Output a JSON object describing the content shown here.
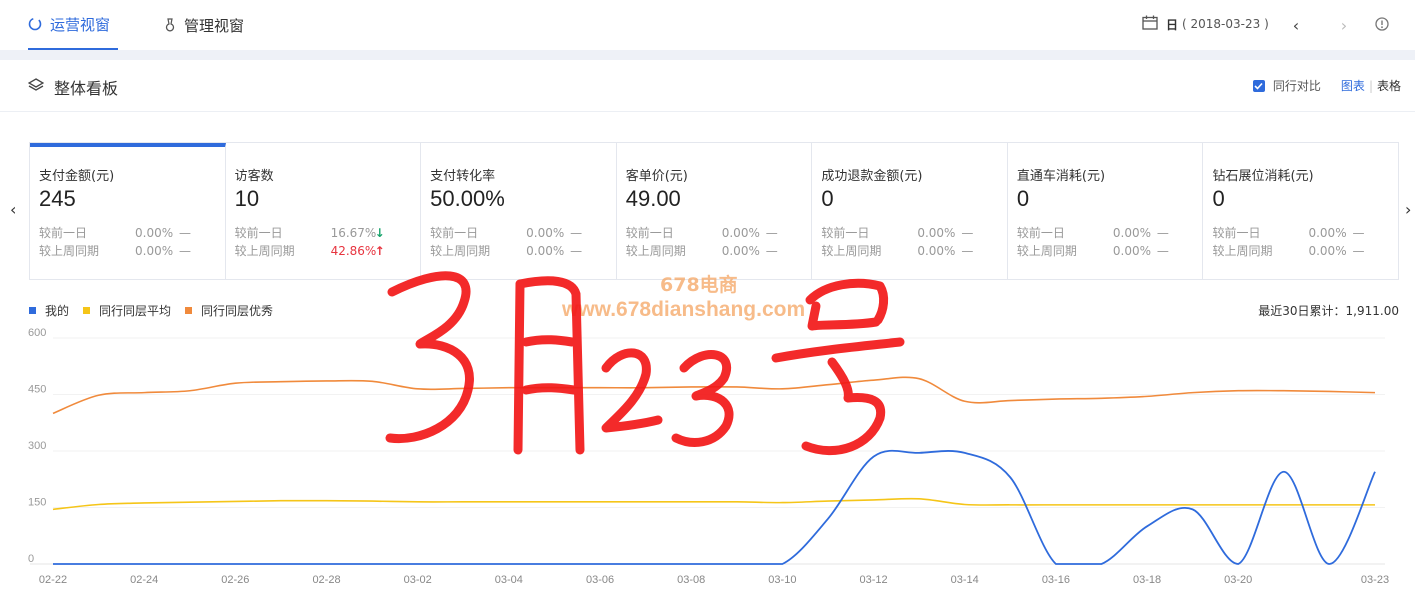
{
  "tabs": [
    {
      "label": "运营视窗",
      "active": true
    },
    {
      "label": "管理视窗",
      "active": false
    }
  ],
  "date": {
    "unit": "日",
    "value": "( 2018-03-23 )"
  },
  "section": {
    "title": "整体看板",
    "compare_label": "同行对比",
    "view_chart": "图表",
    "view_table": "表格",
    "separator": "|"
  },
  "metrics": [
    {
      "name": "支付金额(元)",
      "value": "245",
      "rows": [
        {
          "label": "较前一日",
          "pct": "0.00%",
          "trend": "—"
        },
        {
          "label": "较上周同期",
          "pct": "0.00%",
          "trend": "—"
        }
      ]
    },
    {
      "name": "访客数",
      "value": "10",
      "rows": [
        {
          "label": "较前一日",
          "pct": "16.67%",
          "trend": "↓"
        },
        {
          "label": "较上周同期",
          "pct": "42.86%",
          "trend": "↑"
        }
      ]
    },
    {
      "name": "支付转化率",
      "value": "50.00%",
      "rows": [
        {
          "label": "较前一日",
          "pct": "0.00%",
          "trend": "—"
        },
        {
          "label": "较上周同期",
          "pct": "0.00%",
          "trend": "—"
        }
      ]
    },
    {
      "name": "客单价(元)",
      "value": "49.00",
      "rows": [
        {
          "label": "较前一日",
          "pct": "0.00%",
          "trend": "—"
        },
        {
          "label": "较上周同期",
          "pct": "0.00%",
          "trend": "—"
        }
      ]
    },
    {
      "name": "成功退款金额(元)",
      "value": "0",
      "rows": [
        {
          "label": "较前一日",
          "pct": "0.00%",
          "trend": "—"
        },
        {
          "label": "较上周同期",
          "pct": "0.00%",
          "trend": "—"
        }
      ]
    },
    {
      "name": "直通车消耗(元)",
      "value": "0",
      "rows": [
        {
          "label": "较前一日",
          "pct": "0.00%",
          "trend": "—"
        },
        {
          "label": "较上周同期",
          "pct": "0.00%",
          "trend": "—"
        }
      ]
    },
    {
      "name": "钻石展位消耗(元)",
      "value": "0",
      "rows": [
        {
          "label": "较前一日",
          "pct": "0.00%",
          "trend": "—"
        },
        {
          "label": "较上周同期",
          "pct": "0.00%",
          "trend": "—"
        }
      ]
    }
  ],
  "legend_total": "最近30日累计：1,911.00",
  "watermark": {
    "line1": "678电商",
    "line2": "www.678dianshang.com"
  },
  "handwriting": "3月23号",
  "colors": {
    "accent": "#2f6bdc",
    "mine": "#2f6bdc",
    "avg": "#f5c518",
    "excellent": "#f08a3c",
    "up": "#e7343f",
    "down": "#17a36b"
  },
  "chart_data": {
    "type": "line",
    "x": [
      "02-22",
      "02-23",
      "02-24",
      "02-25",
      "02-26",
      "02-27",
      "02-28",
      "03-01",
      "03-02",
      "03-03",
      "03-04",
      "03-05",
      "03-06",
      "03-07",
      "03-08",
      "03-09",
      "03-10",
      "03-11",
      "03-12",
      "03-13",
      "03-14",
      "03-15",
      "03-16",
      "03-17",
      "03-18",
      "03-19",
      "03-20",
      "03-21",
      "03-22",
      "03-23"
    ],
    "x_ticks": [
      "02-22",
      "02-24",
      "02-26",
      "02-28",
      "03-02",
      "03-04",
      "03-06",
      "03-08",
      "03-10",
      "03-12",
      "03-14",
      "03-16",
      "03-18",
      "03-20",
      "03-23"
    ],
    "y_ticks": [
      0,
      150,
      300,
      450,
      600
    ],
    "ylim": [
      0,
      600
    ],
    "legend_position": "top-left",
    "series": [
      {
        "name": "我的",
        "color": "#2f6bdc",
        "values": [
          0,
          0,
          0,
          0,
          0,
          0,
          0,
          0,
          0,
          0,
          0,
          0,
          0,
          0,
          0,
          0,
          0,
          120,
          285,
          295,
          295,
          230,
          0,
          0,
          100,
          145,
          0,
          245,
          0,
          245
        ]
      },
      {
        "name": "同行同层平均",
        "color": "#f5c518",
        "values": [
          145,
          158,
          162,
          164,
          166,
          168,
          168,
          167,
          165,
          165,
          165,
          165,
          165,
          165,
          165,
          165,
          163,
          167,
          170,
          173,
          158,
          157,
          157,
          157,
          157,
          157,
          157,
          157,
          157,
          157
        ]
      },
      {
        "name": "同行同层优秀",
        "color": "#f08a3c",
        "values": [
          400,
          448,
          455,
          460,
          480,
          484,
          486,
          485,
          465,
          466,
          468,
          468,
          468,
          468,
          470,
          470,
          465,
          476,
          488,
          492,
          432,
          434,
          438,
          440,
          445,
          455,
          460,
          460,
          458,
          455
        ]
      }
    ]
  }
}
